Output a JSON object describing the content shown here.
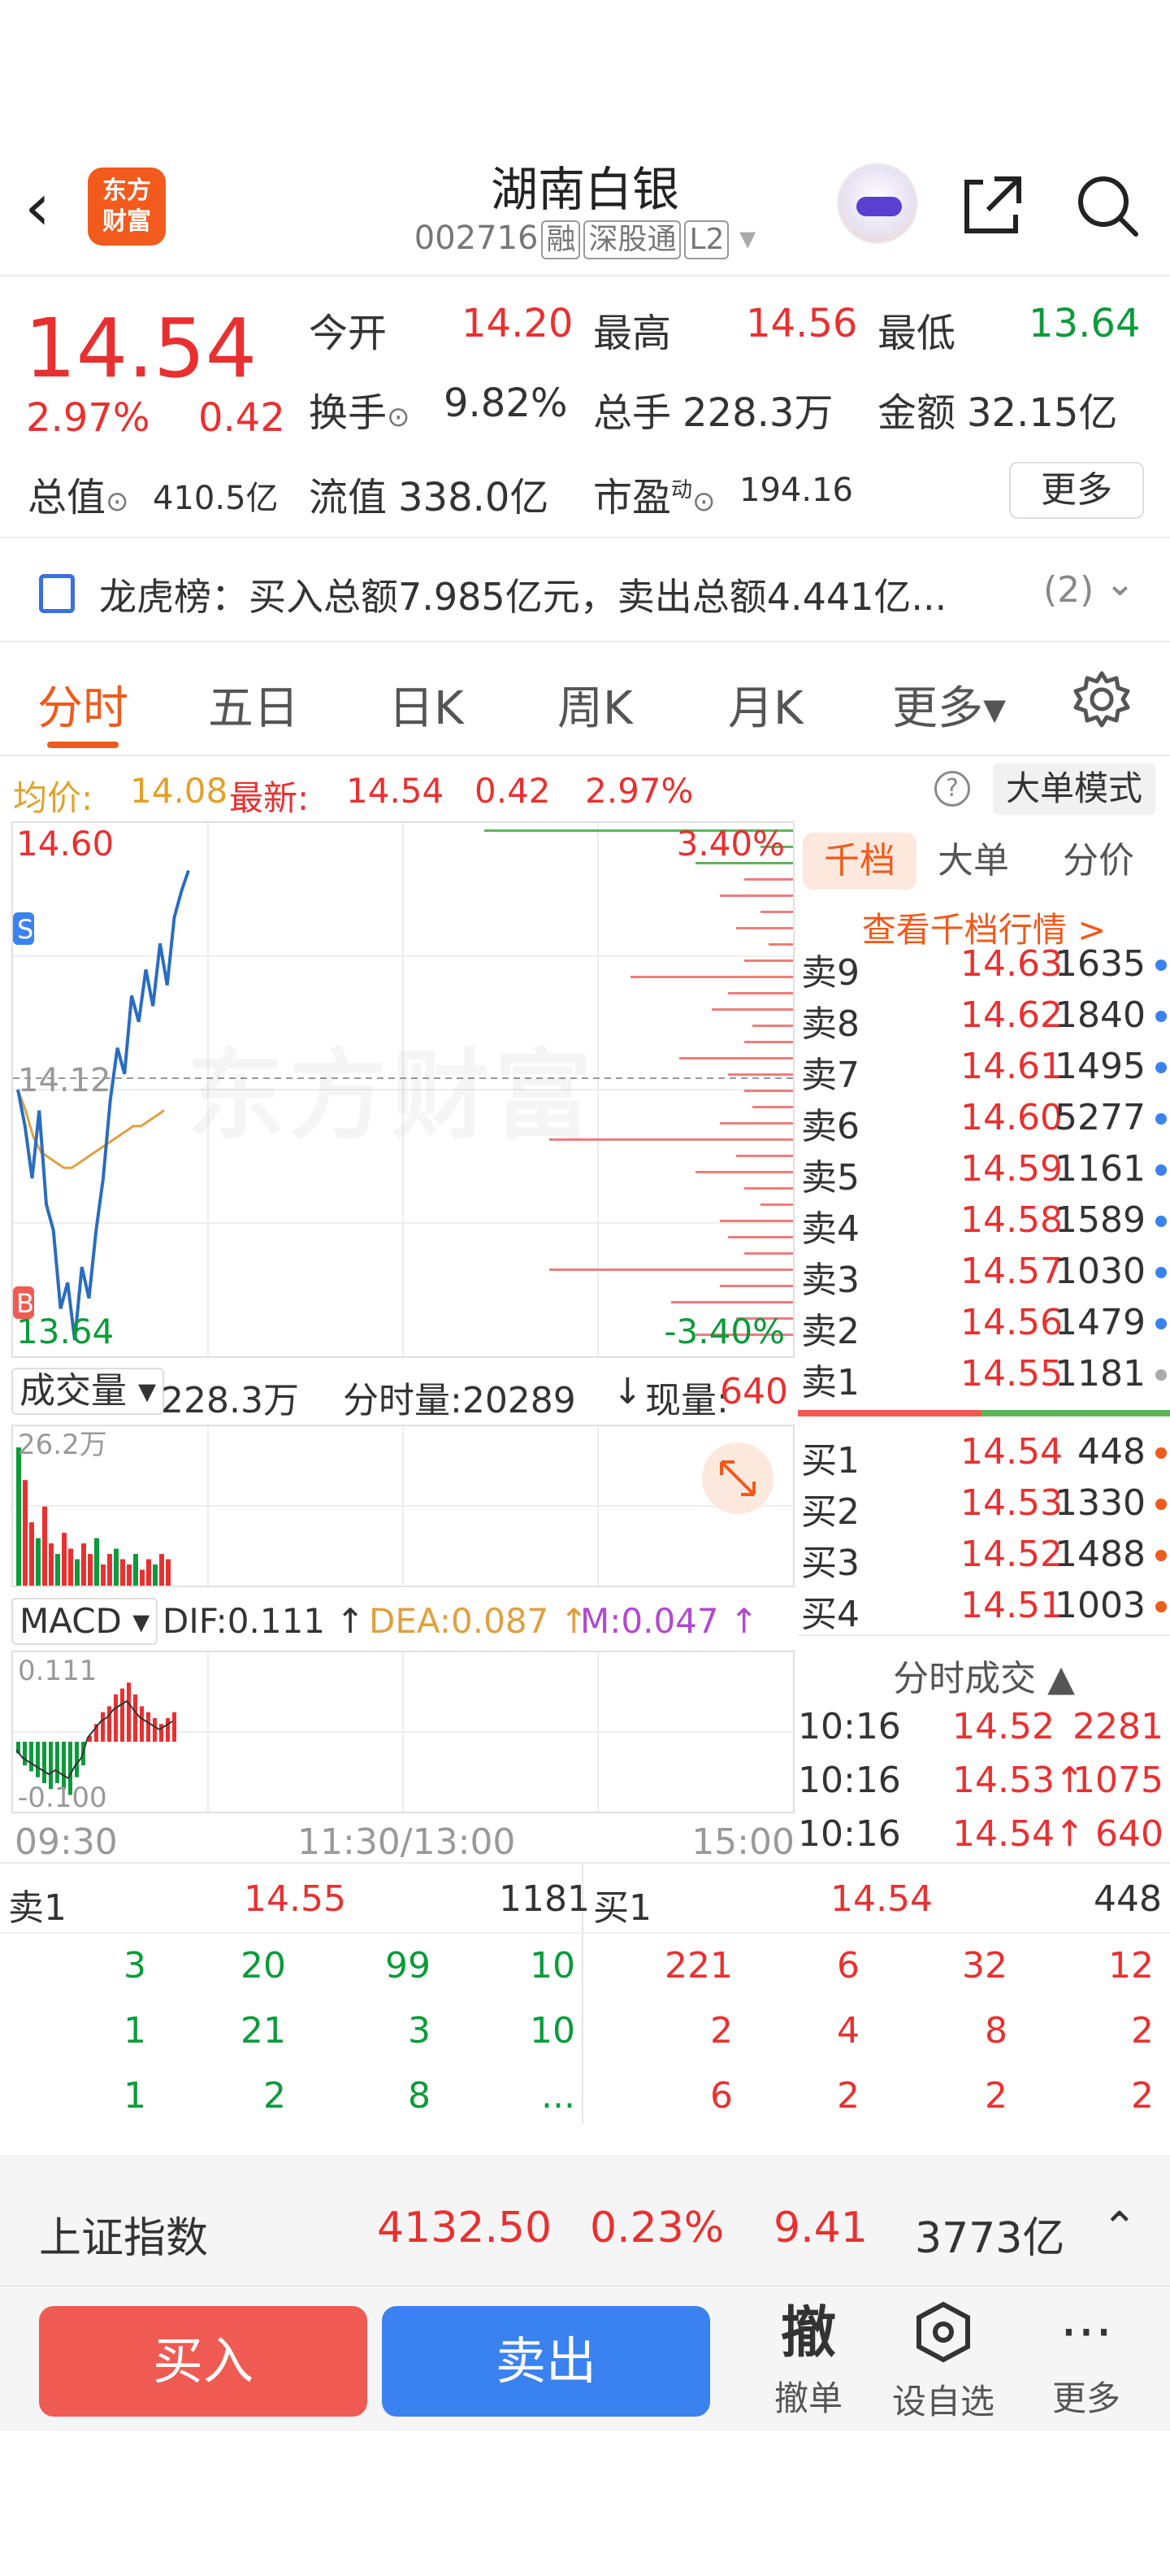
{
  "header": {
    "logo_text_line1": "东方",
    "logo_text_line2": "财富",
    "title": "湖南白银",
    "code": "002716",
    "tags": [
      "融",
      "深股通",
      "L2"
    ]
  },
  "quote": {
    "price": "14.54",
    "change_pct": "2.97%",
    "change_amt": "0.42",
    "open_label": "今开",
    "open_value": "14.20",
    "high_label": "最高",
    "high_value": "14.56",
    "low_label": "最低",
    "low_value": "13.64",
    "turnover_label": "换手",
    "turnover_value": "9.82%",
    "volume_label": "总手",
    "volume_value": "228.3万",
    "amount_label": "金额",
    "amount_value": "32.15亿",
    "mktcap_label": "总值",
    "mktcap_value": "410.5亿",
    "float_label": "流值",
    "float_value": "338.0亿",
    "pe_label": "市盈",
    "pe_sup": "动",
    "pe_value": "194.16",
    "more_label": "更多"
  },
  "banner": {
    "text": "龙虎榜：买入总额7.985亿元，卖出总额4.441亿...",
    "count": "(2)"
  },
  "tabs": [
    "分时",
    "五日",
    "日K",
    "周K",
    "月K",
    "更多▾"
  ],
  "avgbar": {
    "avg_label": "均价:",
    "avg_value": "14.08",
    "latest_label": "最新:",
    "latest_value": "14.54",
    "chg": "0.42",
    "pct": "2.97%",
    "mode_label": "大单模式"
  },
  "chart_data": {
    "type": "line",
    "top_left": "14.60",
    "bottom_left": "13.64",
    "top_right": "3.40%",
    "bottom_right": "-3.40%",
    "ref_label": "14.12",
    "ylim": [
      13.64,
      14.6
    ],
    "price": [
      14.12,
      14.05,
      13.95,
      14.08,
      13.9,
      13.85,
      13.7,
      13.75,
      13.64,
      13.78,
      13.72,
      13.85,
      13.95,
      14.1,
      14.2,
      14.15,
      14.3,
      14.25,
      14.35,
      14.28,
      14.4,
      14.32,
      14.45,
      14.5,
      14.54
    ],
    "avg": [
      14.12,
      14.08,
      14.03,
      14.0,
      13.99,
      13.98,
      13.97,
      13.97,
      13.98,
      13.99,
      14.0,
      14.01,
      14.02,
      14.03,
      14.04,
      14.05,
      14.05,
      14.06,
      14.07,
      14.08
    ],
    "watermark": "东方财富"
  },
  "volume": {
    "label": "成交量",
    "total": "228.3万",
    "tick_label": "分时量:20289",
    "now_label": "现量:",
    "now_value": "640",
    "max_label": "26.2万",
    "bars": [
      26.2,
      20,
      12,
      9,
      15,
      8,
      6,
      10,
      7,
      5,
      8,
      6,
      9,
      4,
      6,
      7,
      5,
      4,
      6,
      3,
      5,
      4,
      6,
      5
    ]
  },
  "macd": {
    "label": "MACD",
    "dif": "DIF:0.111",
    "dea": "DEA:0.087",
    "m": "M:0.047",
    "top_label": "0.111",
    "bottom_label": "-0.100",
    "hist": [
      -0.02,
      -0.04,
      -0.05,
      -0.06,
      -0.07,
      -0.08,
      -0.07,
      -0.08,
      -0.09,
      -0.06,
      -0.04,
      0.01,
      0.03,
      0.05,
      0.06,
      0.08,
      0.09,
      0.1,
      0.08,
      0.06,
      0.05,
      0.04,
      0.03,
      0.04,
      0.05
    ]
  },
  "time_axis": [
    "09:30",
    "11:30/13:00",
    "15:00"
  ],
  "orderbook": {
    "tabs": [
      "千档",
      "大单",
      "分价"
    ],
    "link": "查看千档行情 >",
    "sells": [
      {
        "label": "卖9",
        "price": "14.63",
        "vol": "1635"
      },
      {
        "label": "卖8",
        "price": "14.62",
        "vol": "1840"
      },
      {
        "label": "卖7",
        "price": "14.61",
        "vol": "1495"
      },
      {
        "label": "卖6",
        "price": "14.60",
        "vol": "5277"
      },
      {
        "label": "卖5",
        "price": "14.59",
        "vol": "1161"
      },
      {
        "label": "卖4",
        "price": "14.58",
        "vol": "1589"
      },
      {
        "label": "卖3",
        "price": "14.57",
        "vol": "1030"
      },
      {
        "label": "卖2",
        "price": "14.56",
        "vol": "1479"
      },
      {
        "label": "卖1",
        "price": "14.55",
        "vol": "1181"
      }
    ],
    "buys": [
      {
        "label": "买1",
        "price": "14.54",
        "vol": "448"
      },
      {
        "label": "买2",
        "price": "14.53",
        "vol": "1330"
      },
      {
        "label": "买3",
        "price": "14.52",
        "vol": "1488"
      },
      {
        "label": "买4",
        "price": "14.51",
        "vol": "1003"
      }
    ],
    "trades_title": "分时成交 ▲",
    "trades": [
      {
        "time": "10:16",
        "price": "14.52",
        "vol": "2281"
      },
      {
        "time": "10:16",
        "price": "14.53↑",
        "vol": "1075"
      },
      {
        "time": "10:16",
        "price": "14.54↑",
        "vol": "640"
      }
    ]
  },
  "depth": {
    "sell_label": "卖1",
    "sell_price": "14.55",
    "sell_vol": "1181",
    "buy_label": "买1",
    "buy_price": "14.54",
    "buy_vol": "448",
    "sell_rows": [
      [
        "3",
        "20",
        "99",
        "10"
      ],
      [
        "1",
        "21",
        "3",
        "10"
      ],
      [
        "1",
        "2",
        "8",
        "..."
      ]
    ],
    "buy_rows": [
      [
        "221",
        "6",
        "32",
        "12"
      ],
      [
        "2",
        "4",
        "8",
        "2"
      ],
      [
        "6",
        "2",
        "2",
        "2"
      ]
    ]
  },
  "index_bar": {
    "name": "上证指数",
    "value": "4132.50",
    "pct": "0.23%",
    "chg": "9.41",
    "amount": "3773亿"
  },
  "actions": {
    "buy": "买入",
    "sell": "卖出",
    "cancel_icon": "撤",
    "cancel": "撤单",
    "watch": "设自选",
    "more": "更多"
  },
  "colors": {
    "up": "#e93030",
    "down": "#0b9b3a",
    "accent": "#f05a1a",
    "blue": "#3b82f1"
  }
}
